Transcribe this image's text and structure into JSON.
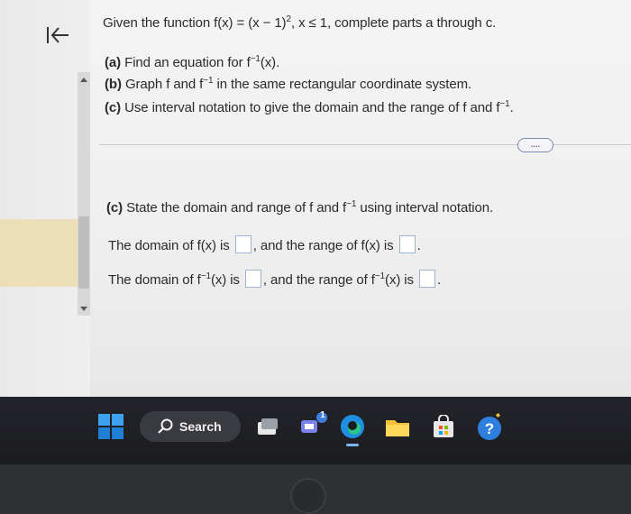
{
  "question": {
    "intro_prefix": "Given the function f(x) = (x − 1)",
    "intro_exp": "2",
    "intro_suffix": ", x ≤ 1, complete parts a through c.",
    "part_a_label": "(a)",
    "part_a_text": "Find an equation for f",
    "part_a_tail": "(x).",
    "part_b_label": "(b)",
    "part_b_text": "Graph f and f",
    "part_b_tail": " in the same rectangular coordinate system.",
    "part_c_label": "(c)",
    "part_c_text": "Use interval notation to give the domain and the range of f and f",
    "inv_exp": "−1"
  },
  "more_button": "....",
  "section_c": {
    "label": "(c)",
    "heading_text": "State the domain and range of f and f",
    "heading_tail": " using interval notation.",
    "line1_a": "The domain of f(x) is ",
    "line1_b": ", and the range of f(x) is ",
    "line2_a": "The domain of f",
    "line2_b": "(x) is ",
    "line2_c": ", and the range of f",
    "line2_d": "(x) is ",
    "period": "."
  },
  "taskbar": {
    "search_label": "Search",
    "chat_badge": "1"
  }
}
